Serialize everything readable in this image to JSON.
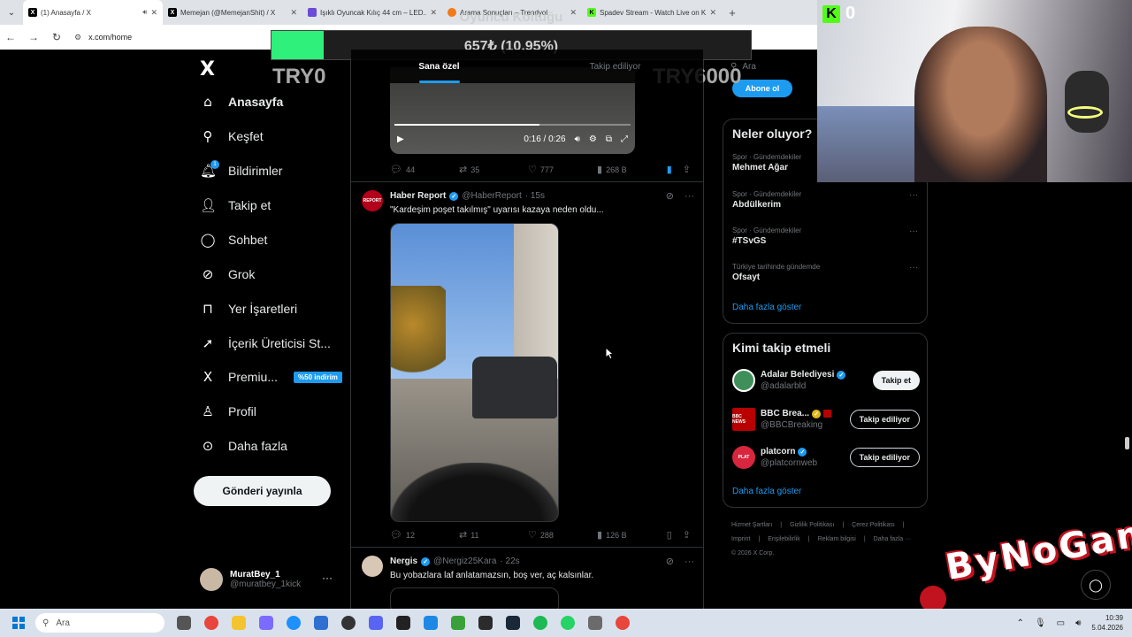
{
  "browser": {
    "tabs": [
      {
        "title": "(1) Anasayfa / X",
        "icon": "x-logo-icon",
        "active": true,
        "audio": true
      },
      {
        "title": "Memejan (@MemejanShit) / X",
        "icon": "x-logo-icon"
      },
      {
        "title": "Işıklı Oyuncak Kılıç 44 cm – LED...",
        "icon": "shop-icon"
      },
      {
        "title": "Arama Sonuçları – Trendyol",
        "icon": "trendyol-icon"
      },
      {
        "title": "Spadev Stream - Watch Live on K...",
        "icon": "kick-icon"
      }
    ],
    "new_tab": "+",
    "url": "x.com/home"
  },
  "nav": {
    "logo": "X",
    "items": [
      {
        "label": "Anasayfa",
        "icon": "home-icon",
        "bold": true
      },
      {
        "label": "Keşfet",
        "icon": "search-icon"
      },
      {
        "label": "Bildirimler",
        "icon": "bell-icon",
        "badge": "1"
      },
      {
        "label": "Takip et",
        "icon": "person-add-icon"
      },
      {
        "label": "Sohbet",
        "icon": "chat-icon"
      },
      {
        "label": "Grok",
        "icon": "grok-icon"
      },
      {
        "label": "Yer İşaretleri",
        "icon": "bookmark-icon"
      },
      {
        "label": "İçerik Üreticisi St...",
        "icon": "rocket-icon"
      },
      {
        "label": "Premiu...",
        "icon": "x-premium-icon",
        "promo": "%50 indirim"
      },
      {
        "label": "Profil",
        "icon": "profile-icon"
      },
      {
        "label": "Daha fazla",
        "icon": "more-circle-icon"
      }
    ],
    "post_button": "Gönderi yayınla",
    "account": {
      "name": "MuratBey_1",
      "handle": "@muratbey_1kick",
      "more": "···"
    }
  },
  "feed": {
    "tabs": [
      {
        "label": "Sana özel",
        "selected": true
      },
      {
        "label": "Takip ediliyor",
        "selected": false
      }
    ],
    "video_player": {
      "time": "0:16 / 0:26",
      "progress": 0.615
    },
    "tweet1_stats": {
      "replies": "44",
      "reposts": "35",
      "likes": "777",
      "views": "268 B"
    },
    "tweet2": {
      "name": "Haber Report",
      "avatar_text": "REPORT",
      "handle": "@HaberReport",
      "time": "· 15s",
      "text": "\"Kardeşim poşet takılmış\" uyarısı kazaya neden oldu...",
      "stats": {
        "replies": "12",
        "reposts": "11",
        "likes": "288",
        "views": "126 B"
      }
    },
    "tweet3": {
      "name": "Nergis",
      "handle": "@Nergiz25Kara",
      "time": "· 22s",
      "text": "Bu yobazlara laf anlatamazsın,  boş ver,  aç kalsınlar."
    }
  },
  "sidebar": {
    "search_placeholder": "Ara",
    "subscribe": "Abone ol",
    "trends_title": "Neler oluyor?",
    "trends": [
      {
        "category": "Spor · Gündemdekiler",
        "name": "Mehmet Ağar"
      },
      {
        "category": "Spor · Gündemdekiler",
        "name": "Abdülkerim"
      },
      {
        "category": "Spor · Gündemdekiler",
        "name": "#TSvGS"
      },
      {
        "category": "Türkiye tarihinde gündemde",
        "name": "Ofsayt"
      }
    ],
    "show_more": "Daha fazla göster",
    "who_to_follow_title": "Kimi takip etmeli",
    "suggestions": [
      {
        "name": "Adalar Belediyesi",
        "handle": "@adalarbld",
        "button": "Takip et",
        "following": false,
        "avatar_color": "#3f8f5a",
        "gold": false
      },
      {
        "name": "BBC Brea...",
        "handle": "@BBCBreaking",
        "button": "Takip ediliyor",
        "following": true,
        "avatar_color": "#b80000",
        "avatar_text": "BBC NEWS",
        "gold": true
      },
      {
        "name": "platcorn",
        "handle": "@platcornweb",
        "button": "Takip ediliyor",
        "following": true,
        "avatar_color": "#d7263d",
        "avatar_text": "PLAT",
        "gold": false
      }
    ],
    "show_more2": "Daha fazla göster",
    "footer_links": [
      "Hizmet Şartları",
      "|",
      "Gizlilik Politikası",
      "|",
      "Çerez Politikası",
      "|",
      "Imprint",
      "|",
      "Erişilebilirlik",
      "|",
      "Reklam bilgisi",
      "|",
      "Daha fazla ···",
      "© 2026 X Corp."
    ]
  },
  "stream_overlay": {
    "goal_title": "Oyuncu Koltuğu",
    "goal_amount": "657₺ (10.95%)",
    "goal_progress": 0.1095,
    "goal_min": "TRY0",
    "goal_max": "TRY6000",
    "kick_viewers": "0",
    "watermark": "ByNoGame"
  },
  "taskbar": {
    "search_placeholder": "Ara",
    "time": "10:39",
    "date": "5.04.2026"
  }
}
